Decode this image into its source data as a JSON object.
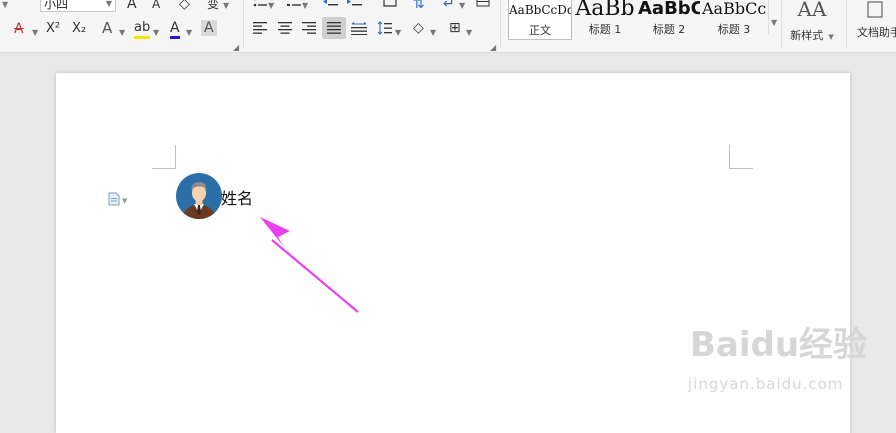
{
  "toolbar": {
    "font_size": "小四",
    "row1_icons": [
      "increase-font-icon",
      "decrease-font-icon",
      "clear-format-icon",
      "phonetic-guide-icon",
      "bullet-list-icon",
      "numbered-list-icon",
      "decrease-indent-icon",
      "increase-indent-icon",
      "chinese-layout-icon",
      "sort-icon",
      "show-marks-icon"
    ],
    "row2_icons": [
      "strikethrough-icon",
      "superscript-icon",
      "subscript-icon",
      "text-effect-icon",
      "highlight-icon",
      "font-color-icon",
      "char-shading-icon",
      "align-left-icon",
      "align-center-icon",
      "align-right-icon",
      "justify-icon",
      "distributed-icon",
      "line-spacing-icon",
      "shading-icon",
      "borders-icon"
    ],
    "glyphs": {
      "increase_font": "A",
      "decrease_font": "A",
      "clear": "◇",
      "phonetic": "变",
      "strike": "A",
      "sup": "X²",
      "sub": "X₂",
      "effect": "A",
      "highlight": "ab",
      "fontcolor": "A",
      "shade": "A",
      "effect2": "A",
      "sort": "⇅",
      "marks": "↵",
      "align_left": "≡",
      "align_center": "≡",
      "align_right": "≡",
      "justify": "≡",
      "distributed": "⟷",
      "line_spacing": "↕",
      "para_shading": "◇",
      "borders": "⊞"
    },
    "accent_colors": {
      "strike": "#c0392b",
      "highlight": "#f5e400",
      "font_color": "#1a1ad6",
      "selected": "#cfcfcf"
    }
  },
  "styles": {
    "items": [
      {
        "preview": "AaBbCcDd",
        "name": "正文"
      },
      {
        "preview": "AaBb",
        "name": "标题 1"
      },
      {
        "preview": "AaBbC",
        "name": "标题 2"
      },
      {
        "preview": "AaBbCc",
        "name": "标题 3"
      }
    ],
    "new_style_label": "新样式",
    "new_style_icon": "AA",
    "doc_assistant_label": "文档助手"
  },
  "document": {
    "name_text": "姓名",
    "avatar_icon": "person-avatar-icon",
    "arrow_color": "#ea3ff0"
  },
  "watermark": {
    "brand": "Baidu经验",
    "url": "jingyan.baidu.com"
  }
}
